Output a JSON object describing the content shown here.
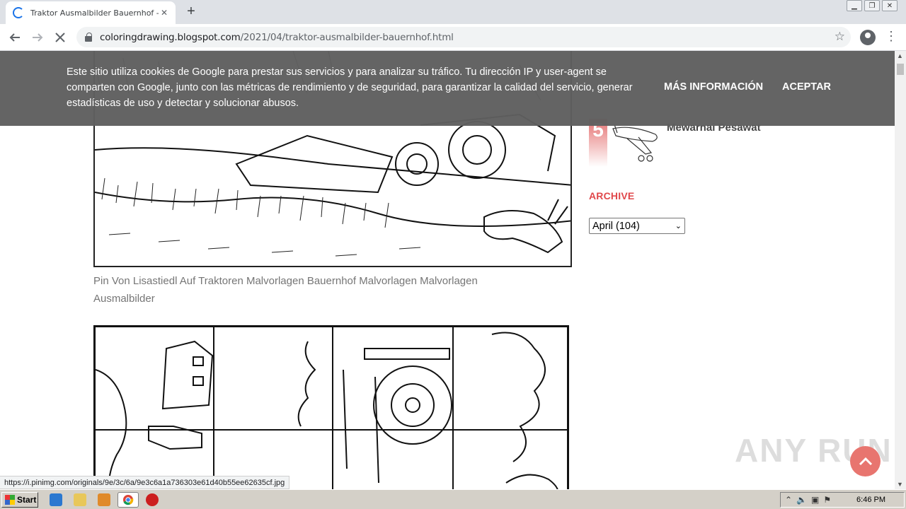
{
  "browser": {
    "tab_title": "Traktor Ausmalbilder Bauernhof - Co",
    "tab_close": "✕",
    "new_tab": "+",
    "url_domain": "coloringdrawing.blogspot.com",
    "url_path": "/2021/04/traktor-ausmalbilder-bauernhof.html",
    "status_url": "https://i.pinimg.com/originals/9e/3c/6a/9e3c6a1a736303e61d40b55ee62635cf.jpg"
  },
  "cookie_banner": {
    "text": "Este sitio utiliza cookies de Google para prestar sus servicios y para analizar su tráfico. Tu dirección IP y user-agent se comparten con Google, junto con las métricas de rendimiento y de seguridad, para garantizar la calidad del servicio, generar estadísticas de uso y detectar y solucionar abusos.",
    "more_label": "MÁS INFORMACIÓN",
    "accept_label": "ACEPTAR"
  },
  "article": {
    "caption": "Pin Von Lisastiedl Auf Traktoren Malvorlagen Bauernhof Malvorlagen Malvorlagen Ausmalbilder"
  },
  "sidebar": {
    "popular_rank": "5",
    "popular_title": "Mewarnai Pesawat",
    "archive_heading": "ARCHIVE",
    "archive_selected": "April (104)"
  },
  "watermark": "ANY RUN",
  "taskbar": {
    "start_label": "Start",
    "clock": "6:46 PM"
  },
  "colors": {
    "accent": "#e0484b",
    "banner": "#5f5f5f",
    "scroll_button": "#e8756f"
  }
}
